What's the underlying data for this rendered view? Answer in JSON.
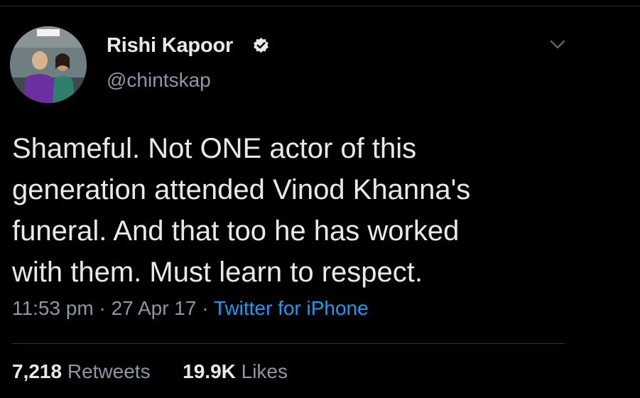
{
  "user": {
    "display_name": "Rishi Kapoor",
    "handle": "@chintskap",
    "verified": true,
    "avatar_icon": "profile-photo"
  },
  "tweet": {
    "lines": [
      "Shameful. Not ONE actor of this",
      "generation attended Vinod Khanna's",
      "funeral. And that too he has worked",
      "with them. Must learn to respect."
    ],
    "time": "11:53 pm",
    "separator": "·",
    "date": "27 Apr 17",
    "source": "Twitter for iPhone"
  },
  "stats": {
    "retweets_count": "7,218",
    "retweets_label": "Retweets",
    "likes_count": "19.9K",
    "likes_label": "Likes"
  },
  "colors": {
    "background": "#000000",
    "text": "#e7e9ea",
    "secondary": "#8b98a5",
    "link": "#1d9bf0"
  }
}
